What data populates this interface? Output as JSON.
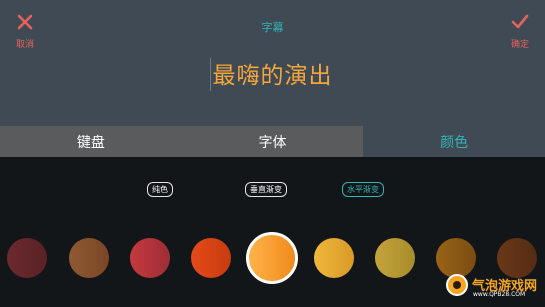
{
  "header": {
    "title": "字幕",
    "cancel_label": "取消",
    "confirm_label": "确定",
    "cancel_icon": "close-icon",
    "confirm_icon": "check-icon"
  },
  "preview_text": "最嗨的演出",
  "tabs": [
    {
      "label": "键盘",
      "active": false
    },
    {
      "label": "字体",
      "active": false
    },
    {
      "label": "颜色",
      "active": true
    }
  ],
  "gradient_types": [
    {
      "label": "纯色",
      "selected": false
    },
    {
      "label": "垂直渐变",
      "selected": false
    },
    {
      "label": "水平渐变",
      "selected": true
    }
  ],
  "swatches": [
    {
      "from": "#6b2a2e",
      "to": "#5a2226",
      "selected": false
    },
    {
      "from": "#8f5a32",
      "to": "#7a4526",
      "selected": false
    },
    {
      "from": "#c43a3e",
      "to": "#9e2d36",
      "selected": false
    },
    {
      "from": "#e54a1a",
      "to": "#c63c10",
      "selected": false
    },
    {
      "from": "#ffb34a",
      "to": "#f08a1c",
      "selected": true
    },
    {
      "from": "#f0b83c",
      "to": "#d99a28",
      "selected": false
    },
    {
      "from": "#c4a43a",
      "to": "#a88c2c",
      "selected": false
    },
    {
      "from": "#9a6418",
      "to": "#7a4c12",
      "selected": false
    },
    {
      "from": "#6a3818",
      "to": "#552c12",
      "selected": false
    }
  ],
  "watermark": {
    "text": "气泡游戏网",
    "url": "www.QPB28.COM"
  },
  "colors": {
    "accent": "#34b3b8",
    "cancel": "#e8625c",
    "preview_text": "#f5a63c",
    "top_bg": "#3f4a54",
    "tab_bg": "#5a5b5d",
    "bottom_bg": "#131619"
  }
}
